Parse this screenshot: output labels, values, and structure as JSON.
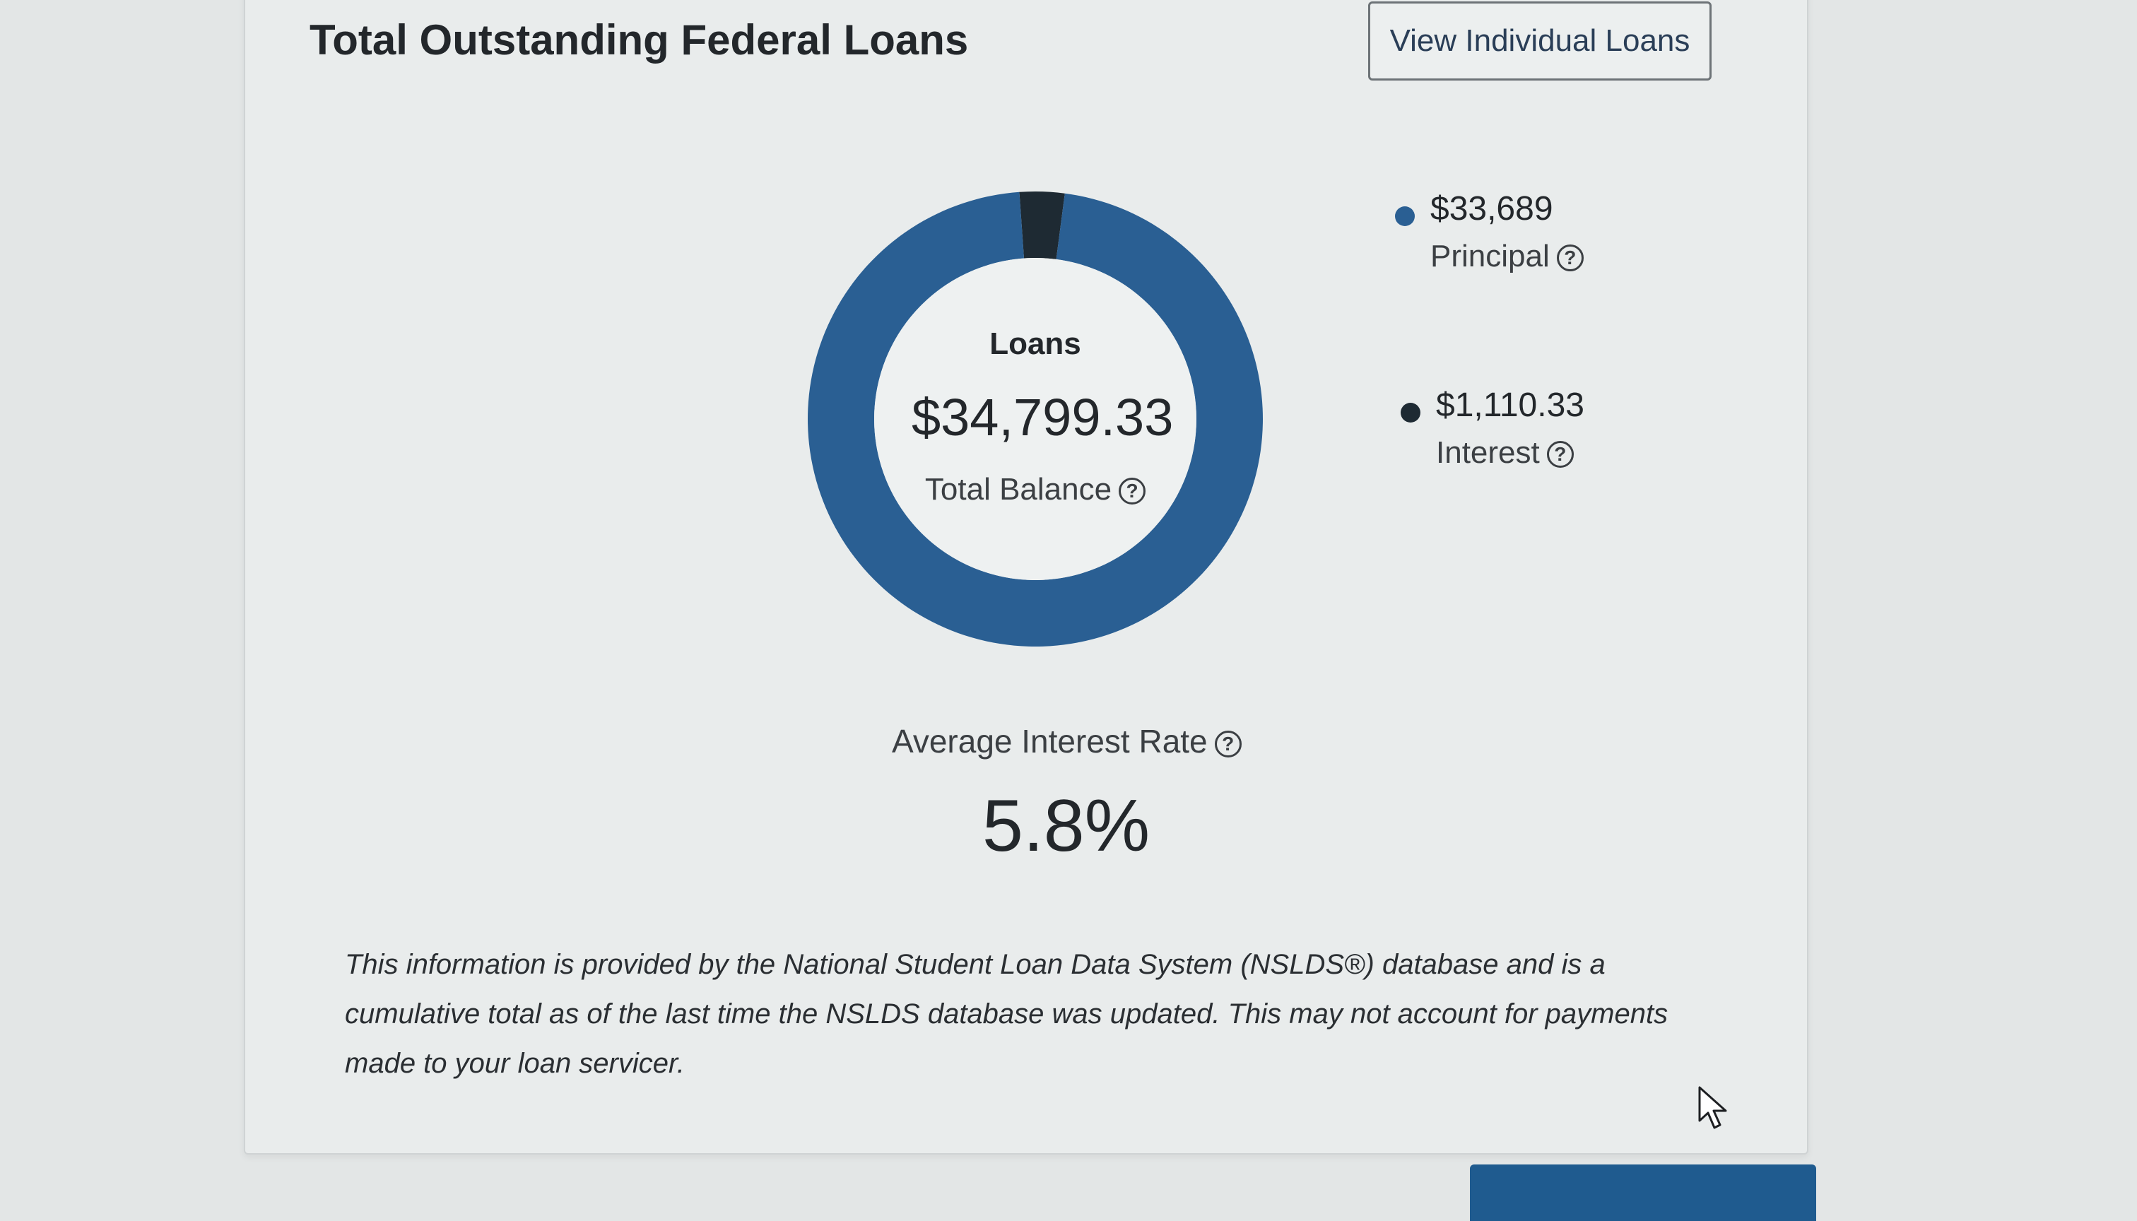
{
  "header": {
    "title": "Total Outstanding Federal Loans",
    "view_button_label": "View Individual Loans"
  },
  "donut": {
    "center_title": "Loans",
    "center_amount": "$34,799.33",
    "center_caption": "Total Balance"
  },
  "legend": [
    {
      "value": "$33,689",
      "label": "Principal",
      "color": "#2a5f93"
    },
    {
      "value": "$1,110.33",
      "label": "Interest",
      "color": "#1e2a33"
    }
  ],
  "chart_data": {
    "type": "pie",
    "categories": [
      "Principal",
      "Interest"
    ],
    "values": [
      33689,
      1110.33
    ],
    "colors": [
      "#2a5f93",
      "#1e2a33"
    ],
    "title": "Loans",
    "legend": "right"
  },
  "rate": {
    "label": "Average Interest Rate",
    "value": "5.8%"
  },
  "disclaimer": "This information is provided by the National Student Loan Data System (NSLDS®) database and is a cumulative total as of the last time the NSLDS database was updated. This may not account for payments made to your loan servicer.",
  "help_icon_glyph": "?",
  "icons": [
    "help-icon",
    "cursor-arrow-icon"
  ]
}
